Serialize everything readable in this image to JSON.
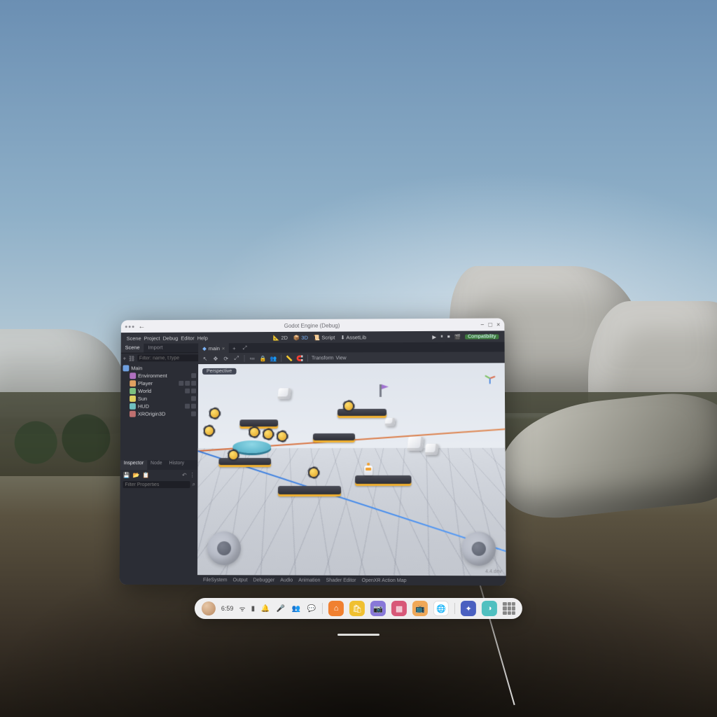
{
  "vr_taskbar": {
    "time": "6:59",
    "sys_icons": [
      "bell",
      "mic",
      "people",
      "chat"
    ]
  },
  "editor": {
    "titlebar": {
      "title": "Godot Engine (Debug)"
    },
    "menubar": {
      "items": [
        "Scene",
        "Project",
        "Debug",
        "Editor",
        "Help"
      ],
      "modes": {
        "m2d": "2D",
        "m3d": "3D",
        "script": "Script",
        "assetlib": "AssetLib"
      },
      "compat": "Compatibility"
    },
    "scene_dock": {
      "tab_scene": "Scene",
      "tab_import": "Import",
      "filter_placeholder": "Filter: name, t:type",
      "tree": {
        "root": "Main",
        "items": [
          "Environment",
          "Player",
          "World",
          "Sun",
          "HUD",
          "XROrigin3D"
        ]
      }
    },
    "inspector": {
      "tab_inspector": "Inspector",
      "tab_node": "Node",
      "tab_history": "History",
      "filter_placeholder": "Filter Properties"
    },
    "viewport": {
      "scene_tab": "main",
      "persp_btn": "Perspective",
      "tool_menu": {
        "transform": "Transform",
        "view": "View"
      }
    },
    "bottom_panel": {
      "tabs": [
        "FileSystem",
        "Output",
        "Debugger",
        "Audio",
        "Animation",
        "Shader Editor",
        "OpenXR Action Map"
      ],
      "version": "4.4.dev"
    }
  }
}
